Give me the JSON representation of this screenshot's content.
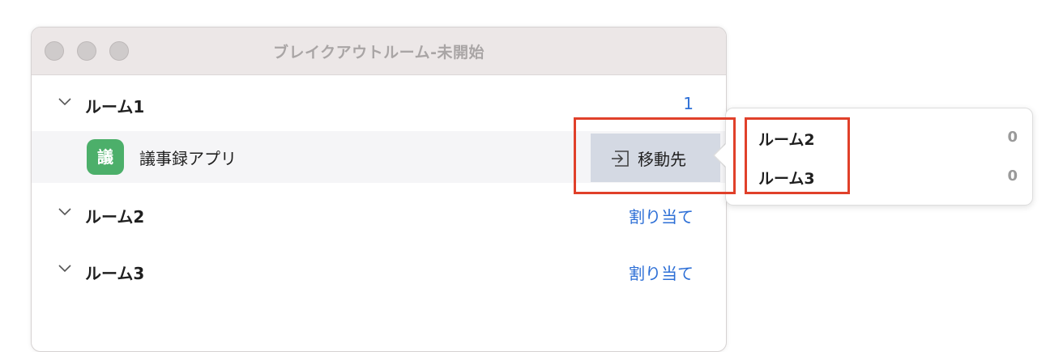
{
  "window": {
    "title": "ブレイクアウトルーム-未開始"
  },
  "rooms": [
    {
      "name": "ルーム1",
      "right_text": "1"
    },
    {
      "name": "ルーム2",
      "right_text": "割り当て"
    },
    {
      "name": "ルーム3",
      "right_text": "割り当て"
    }
  ],
  "member": {
    "avatar_text": "議",
    "name": "議事録アプリ",
    "move_label": "移動先",
    "avatar_color": "#4caf6a"
  },
  "move_menu": {
    "items": [
      {
        "name": "ルーム2",
        "count": "0"
      },
      {
        "name": "ルーム3",
        "count": "0"
      }
    ]
  },
  "colors": {
    "link": "#2d6fd6",
    "highlight": "#e0402a"
  }
}
